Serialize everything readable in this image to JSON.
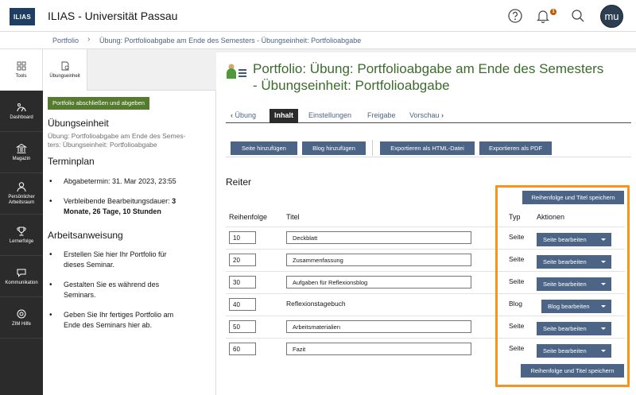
{
  "header": {
    "logo_text": "ILIAS",
    "site_title": "ILIAS - Universität Passau",
    "notification_count": "1",
    "avatar_initials": "mu"
  },
  "breadcrumb": {
    "items": [
      "Portfolio",
      "Übung: Portfolioabgabe am Ende des Semesters - Übungseinheit: Portfolioabgabe"
    ]
  },
  "mainbar": {
    "tools_label": "Tools",
    "items": [
      "Dashboard",
      "Magazin",
      "Persönlicher Arbeitsraum",
      "Lernerfolge",
      "Kommunikation",
      "ZIM Hilfe"
    ]
  },
  "slate": {
    "tab_label": "Übungseinheit",
    "submit_button": "Portfolio abschließen und abgeben",
    "unit_heading": "Übungseinheit",
    "unit_text_line1": "Übung: Portfolioabgabe am Ende des Semes-",
    "unit_text_line2": "ters: Übungseinheit: Portfolioabgabe",
    "schedule_heading": "Terminplan",
    "deadline": "Abgabetermin: 31. Mar 2023, 23:55",
    "remaining_prefix": "Verbleibende Bearbeitungsdauer: ",
    "remaining_value_line1": "3",
    "remaining_value_line2": "Monate, 26 Tage, 10 Stunden",
    "instructions_heading": "Arbeitsanweisung",
    "instructions": [
      [
        "Erstellen Sie hier Ihr Portfolio für",
        "dieses Seminar."
      ],
      [
        "Gestalten Sie es während des",
        "Seminars."
      ],
      [
        "Geben Sie Ihr fertiges Portfolio am",
        "Ende des Seminars hier ab."
      ]
    ]
  },
  "content": {
    "title_line1": "Portfolio: Übung: Portfolioabgabe am Ende des Semesters",
    "title_line2": "- Übungseinheit: Portfolioabgabe",
    "tabs": {
      "back": "Übung",
      "items": [
        "Inhalt",
        "Einstellungen",
        "Freigabe",
        "Vorschau"
      ],
      "active": "Inhalt"
    },
    "toolbar": {
      "add_page": "Seite hinzufügen",
      "add_blog": "Blog hinzufügen",
      "export_html": "Exportieren als HTML-Datei",
      "export_pdf": "Exportieren als PDF"
    },
    "section_title": "Reiter",
    "save_button": "Reihenfolge und Titel speichern",
    "columns": {
      "order": "Reihenfolge",
      "title": "Titel",
      "type": "Typ",
      "actions": "Aktionen"
    },
    "rows": [
      {
        "order": "10",
        "title": "Deckblatt",
        "type": "Seite",
        "action": "Seite bearbeiten",
        "editable_title": true
      },
      {
        "order": "20",
        "title": "Zusammenfassung",
        "type": "Seite",
        "action": "Seite bearbeiten",
        "editable_title": true
      },
      {
        "order": "30",
        "title": "Aufgaben für Reflexionsblog",
        "type": "Seite",
        "action": "Seite bearbeiten",
        "editable_title": true
      },
      {
        "order": "40",
        "title": "Reflexionstagebuch",
        "type": "Blog",
        "action": "Blog bearbeiten",
        "editable_title": false
      },
      {
        "order": "50",
        "title": "Arbeitsmaterialien",
        "type": "Seite",
        "action": "Seite bearbeiten",
        "editable_title": true
      },
      {
        "order": "60",
        "title": "Fazit",
        "type": "Seite",
        "action": "Seite bearbeiten",
        "editable_title": true
      }
    ]
  },
  "colors": {
    "primary_button": "#4c6586",
    "submit_button": "#557b2e",
    "title_green": "#3c6b2d",
    "highlight": "#f7941d",
    "mainbar_dark": "#2b2b2b"
  }
}
